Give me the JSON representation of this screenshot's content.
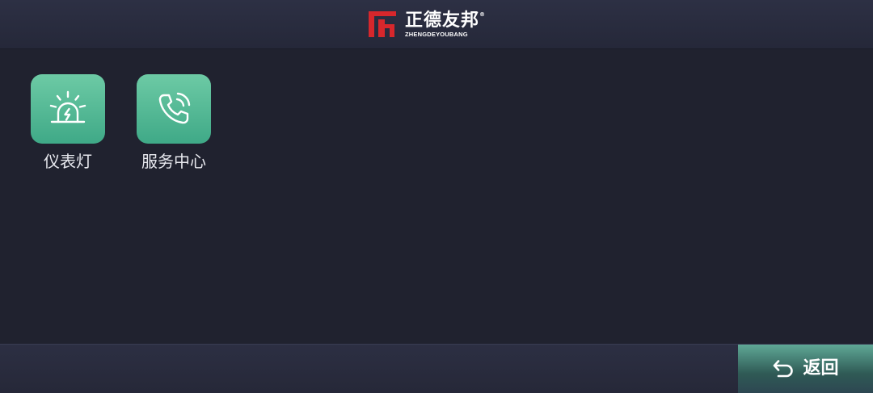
{
  "header": {
    "brand_cn": "正德友邦",
    "brand_reg": "®",
    "brand_en": "ZHENGDEYOUBANG",
    "logo_icon": "brand-logo-mark"
  },
  "apps": [
    {
      "label": "仪表灯",
      "icon": "warning-beacon-icon"
    },
    {
      "label": "服务中心",
      "icon": "phone-call-icon"
    }
  ],
  "footer": {
    "back_label": "返回",
    "back_icon": "return-arrow-icon"
  },
  "colors": {
    "background": "#20222f",
    "header": "#2b2e41",
    "tile": "#4fb893",
    "brand_red": "#d7272c",
    "back_button": "#3e7a70"
  }
}
